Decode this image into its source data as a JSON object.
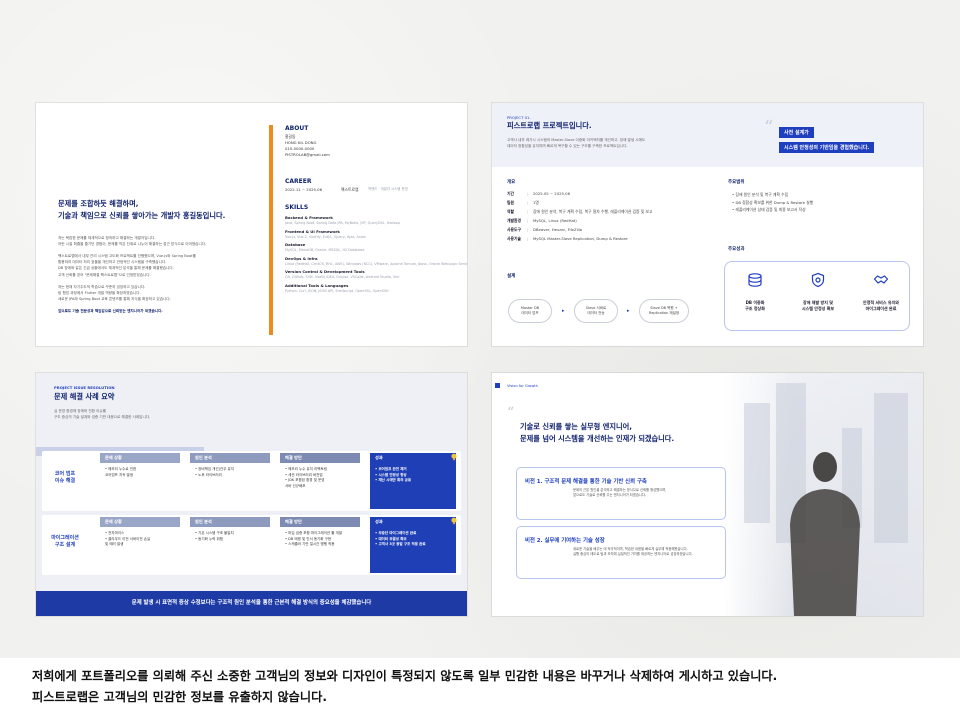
{
  "footer": {
    "line1": "저희에게 포트폴리오를 의뢰해 주신 소중한 고객님의 정보와 디자인이 특정되지 않도록 일부 민감한 내용은 바꾸거나 삭제하여 게시하고 있습니다.",
    "line2": "피스트로랩은 고객님의 민감한 정보를 유출하지 않습니다."
  },
  "slide1": {
    "headline1": "문제를 조합하듯 해결하며,",
    "headline2": "기술과 책임으로 신뢰를 쌓아가는 개발자 홍길동입니다.",
    "body": [
      "저는 복잡한 문제를 체계적으로 정의하고 해결하는 개발자입니다.",
      "어린 시절 퍼즐을 즐기던 경험이, 문제를 작은 단위로 나누어 해결하는 접근 방식으로 이어졌습니다.",
      "",
      "팩스트로랩에서 내부 관리 시스템 고도화 프로젝트를 진행했으며, Vue.js와 Spring Boot를",
      "활용하여 데이터 처리 효율을 개선하고 안정적인 시스템을 구축했습니다.",
      "DB 장애와 같은 긴급 상황에서도 체계적인 분석을 통해 문제를 해결했습니다.",
      "고객 신뢰를 얻어 \"문제해결 팩스트로랩\"으로 인정받았습니다.",
      "",
      "저는 현재 자기주도적 학습으로 꾸준히 성장하고 있습니다.",
      "팀 협업 과정에서 Flutter 개발 역량을 확장하였습니다.",
      "새로운 JPA와 Spring Boot 교육 콘텐츠를 통해 지식을 확장하고 있습니다.",
      "",
      "앞으로도 기술 전문성과 책임감으로 신뢰받는 엔지니어가 되겠습니다."
    ],
    "about_title": "ABOUT",
    "about": [
      "홍길동",
      "HONG KIL DONG",
      "010-0000-0000",
      "PISTROLAB@gmail.com"
    ],
    "career_title": "CAREER",
    "career_period": "2022.11 ~ 2025.06",
    "career_company": "팩스트로랩",
    "career_role": "백엔드 · 개발자 시스템 운영",
    "skills_title": "SKILLS",
    "skills": [
      {
        "name": "Backend & Framework",
        "items": "Java, Spring Boot, Spring Data JPA, MyBatis, JSP, QueryDSL, Hadoop"
      },
      {
        "name": "Frontend & UI Framework",
        "items": "Vue.js, Vue 2, Vuetify, ExtJS, jQuery, Ajax, Axios"
      },
      {
        "name": "Database",
        "items": "MySQL, MariaDB, Oracle, MSSQL, H2 Database"
      },
      {
        "name": "DevOps & Infra",
        "items": "Linux (RedHat, CentOS, RHL, AWS), Windows (NCC), VMware, Apache Tomcat, Jboss, Oracle WebLogic Server"
      },
      {
        "name": "Version Control & Development Tools",
        "items": "Git, Github, SVN, IntelliJ IDEA, Eclipse, VSCode, Android Studio, Vim"
      },
      {
        "name": "Additional Tools & Languages",
        "items": "Python, Curl, JSON, JSON API, Shellscript, OpenSSL, OpenSSH"
      }
    ]
  },
  "slide2": {
    "project_no": "PROJECT 01.",
    "project_title": "피스트로랩 프로젝트입니다.",
    "project_desc1": "고객사 내부 레거시 시스템의 Master-Slave 이중화 아키텍처를 개선하고, 장애 발생 시에도",
    "project_desc2": "데이터 정합성을 유지하며 빠르게 복구할 수 있는 구조를 구축한 프로젝트입니다.",
    "pill1": "사전 설계가",
    "pill2": "시스템 안정성의 기반임을 경험했습니다.",
    "overview_title": "개요",
    "overview": [
      {
        "k": "기간",
        "v": "2025.05 ~ 2025.06"
      },
      {
        "k": "팀원",
        "v": "1명"
      },
      {
        "k": "역할",
        "v": "장애 원인 분석, 복구 계획 수립, 복구 절차 수행, 레플리케이션 검증 및 보고"
      },
      {
        "k": "개발환경",
        "v": "MySQL, Linux (RedHat)"
      },
      {
        "k": "사용도구",
        "v": "DBeaver, Heuarc, FileZilla"
      },
      {
        "k": "사용기술",
        "v": "MySQL Master-Slave Replication, Dump & Restore"
      }
    ],
    "scope_title": "주요범위",
    "scope": [
      "장애 원인 분석 및 복구 계획 수립",
      "DB 정합성 확보를 위한 Dump & Restore 실행",
      "레플리케이션 상태 검증 및 최종 보고서 작성"
    ],
    "design_title": "설계",
    "flow": [
      {
        "l1": "Master DB",
        "l2": "데이터 덤프"
      },
      {
        "l1": "Slave 서버로",
        "l2": "데이터 전송"
      },
      {
        "l1": "Slave DB 복원 +",
        "l2": "Replication 재설정"
      }
    ],
    "effect_title": "주요성과",
    "effects": [
      {
        "l1": "DB 이중화",
        "l2": "구조 정상화"
      },
      {
        "l1": "장애 재발 방지 및",
        "l2": "시스템 안정성 확보"
      },
      {
        "l1": "안정적 서비스 유지와",
        "l2": "마이그레이션 완료"
      }
    ]
  },
  "slide3": {
    "label": "PROJECT ISSUE RESOLUTION",
    "title": "문제 해결 사례 요약",
    "desc1": "실 운영 환경에 장애와 전환 이슈를",
    "desc2": "구조 중심의 기술 설계와 검증 기반 대응으로 해결한 사례입니다.",
    "headers": [
      "문제 상황",
      "원인 분석",
      "해결 방안",
      "성과"
    ],
    "rows": [
      {
        "name1": "코어 덤프",
        "name2": "이슈 해결",
        "problem": [
          "• 메모리 누수로 인한",
          "  코어덤프 지속 발생"
        ],
        "cause": [
          "• 장비책임 개선(관우 유지",
          "• 노후 라이브러리"
        ],
        "solution": [
          "• 메모리 누수 유지 리팩토링",
          "• 세션 라이브러리 버전업",
          "• JDK 포함된 환경 및 운영",
          "  서버 신규배포"
        ],
        "result": [
          "코어덤프 완전 제거",
          "시스템 안정성 향상",
          "재난 시에만 회의 공유"
        ]
      },
      {
        "name1": "마이그레이션",
        "name2": "구조 설계",
        "problem": [
          "• 전자마이스",
          "• 클라우드 이전 서버이전 손실",
          "  및 에러 발생"
        ],
        "cause": [
          "• 기존 시스템 구조 불일치",
          "• 동기화 누락 위험"
        ],
        "solution": [
          "• 마입 검증 포함 마이그레이션 툴 개발",
          "• DB 매핑 및 인서 동기화 구현",
          "• 스케줄러 기반 일시간 병행 적용"
        ],
        "result": [
          "무중단 마이그레이션 완료",
          "데이터 무결성 확보",
          "고객사 3곳 동일 구조 적용 완료"
        ]
      }
    ],
    "bottom": "문제 발생 시 표면적 증상 수정보다는 구조적 원인 분석을 통한 근본적 해결 방식의 중요성을 체감했습니다"
  },
  "slide4": {
    "label": "Vision for Growth",
    "headline1": "기술로 신뢰를 쌓는 실무형 엔지니어,",
    "headline2": "문제를 넘어 시스템을 개선하는 인재가 되겠습니다.",
    "cards": [
      {
        "title": "비전 1.   구조적 문제 해결을 통한 기술 기반 신뢰 구축",
        "t1": "문제의 근본 원인을 분석하고 해결하는 방식으로 신뢰를 형성했으며,",
        "t2": "앞으로도 기술로 신뢰를 주는 엔지니어가 되겠습니다."
      },
      {
        "title": "비전 2.   실무에 기여하는 기술 성장",
        "t1": "새로운 기술을 배우는 데 적극적이며, 학습한 내용을 빠르게 실무에 적용해왔습니다.",
        "t2": "실행 중심의 태도로 팀과 조직에 실질적인 가치를 제공하는 엔지니어로 성장하겠습니다."
      }
    ]
  },
  "colors": {
    "navy": "#0d1f6b",
    "accent_blue": "#1f3fbf",
    "accent_orange": "#f08a1c"
  }
}
